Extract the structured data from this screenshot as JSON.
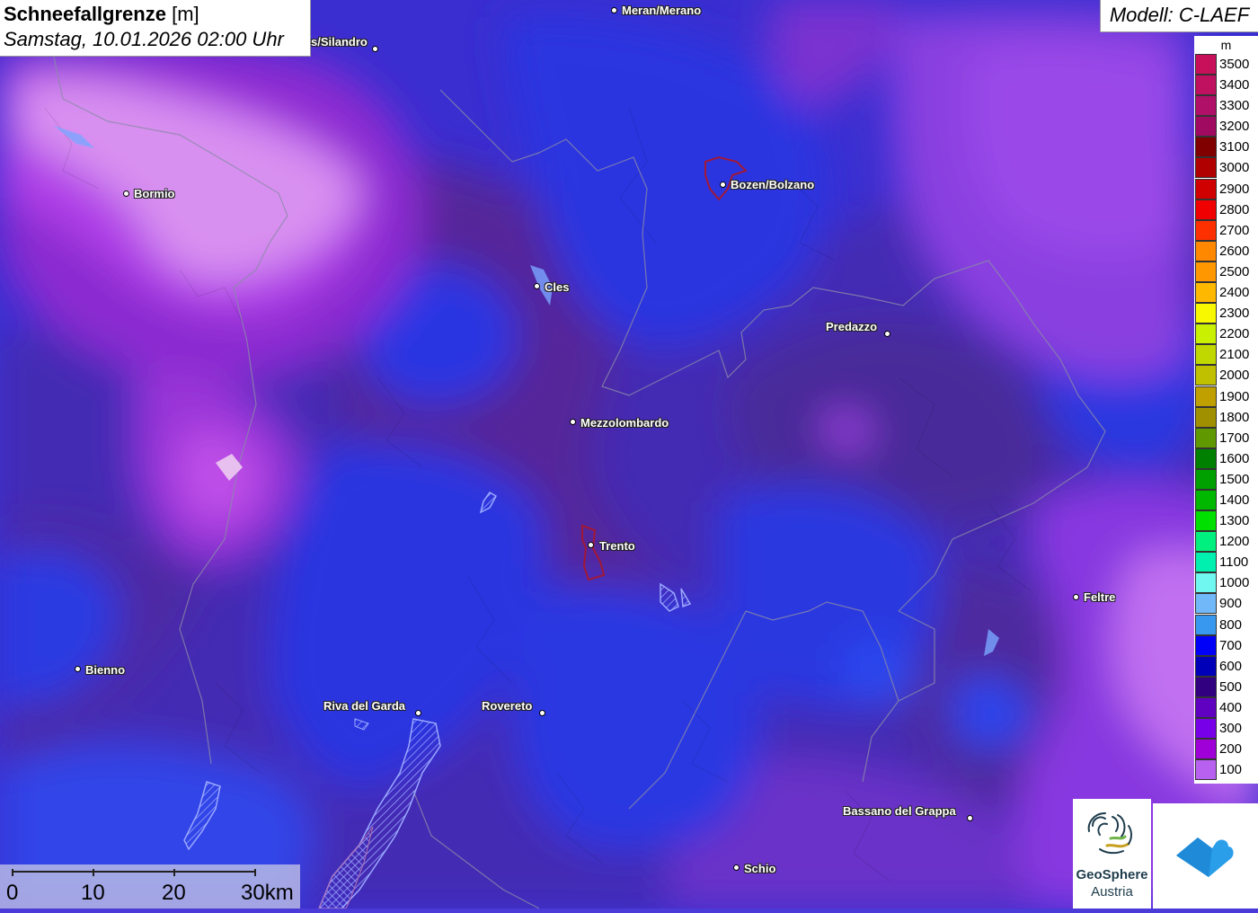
{
  "title": {
    "main": "Schneefallgrenze",
    "unit": "[m]",
    "datetime": "Samstag, 10.01.2026 02:00 Uhr"
  },
  "model_label": "Modell: C-LAEF",
  "legend": {
    "unit": "m",
    "items": [
      {
        "value": "3500",
        "color": "#c8105a"
      },
      {
        "value": "3400",
        "color": "#c01060"
      },
      {
        "value": "3300",
        "color": "#b01068"
      },
      {
        "value": "3200",
        "color": "#a00a60"
      },
      {
        "value": "3100",
        "color": "#800000"
      },
      {
        "value": "3000",
        "color": "#b00000"
      },
      {
        "value": "2900",
        "color": "#d00000"
      },
      {
        "value": "2800",
        "color": "#f00000"
      },
      {
        "value": "2700",
        "color": "#ff3000"
      },
      {
        "value": "2600",
        "color": "#ff8800"
      },
      {
        "value": "2500",
        "color": "#ff9800"
      },
      {
        "value": "2400",
        "color": "#ffb800"
      },
      {
        "value": "2300",
        "color": "#f8f800"
      },
      {
        "value": "2200",
        "color": "#c8f000"
      },
      {
        "value": "2100",
        "color": "#c0d800"
      },
      {
        "value": "2000",
        "color": "#c0c000"
      },
      {
        "value": "1900",
        "color": "#c0a000"
      },
      {
        "value": "1800",
        "color": "#a09000"
      },
      {
        "value": "1700",
        "color": "#609800"
      },
      {
        "value": "1600",
        "color": "#008000"
      },
      {
        "value": "1500",
        "color": "#00a000"
      },
      {
        "value": "1400",
        "color": "#00b800"
      },
      {
        "value": "1300",
        "color": "#00e000"
      },
      {
        "value": "1200",
        "color": "#00f080"
      },
      {
        "value": "1100",
        "color": "#00f0b0"
      },
      {
        "value": "1000",
        "color": "#70f8f0"
      },
      {
        "value": "900",
        "color": "#70b8f8"
      },
      {
        "value": "800",
        "color": "#3898f0"
      },
      {
        "value": "700",
        "color": "#0000f8"
      },
      {
        "value": "600",
        "color": "#0000b8"
      },
      {
        "value": "500",
        "color": "#300080"
      },
      {
        "value": "400",
        "color": "#6000c0"
      },
      {
        "value": "300",
        "color": "#7800e8"
      },
      {
        "value": "200",
        "color": "#a000d8"
      },
      {
        "value": "100",
        "color": "#b860f0"
      }
    ]
  },
  "cities": [
    {
      "name": "Meran/Merano",
      "id": "meran"
    },
    {
      "name": "s/Silandro",
      "id": "silandro"
    },
    {
      "name": "Bormio",
      "id": "bormio"
    },
    {
      "name": "Bozen/Bolzano",
      "id": "bozen"
    },
    {
      "name": "Cles",
      "id": "cles"
    },
    {
      "name": "Predazzo",
      "id": "predazzo"
    },
    {
      "name": "Mezzolombardo",
      "id": "mezzolombardo"
    },
    {
      "name": "Trento",
      "id": "trento"
    },
    {
      "name": "Feltre",
      "id": "feltre"
    },
    {
      "name": "Bienno",
      "id": "bienno"
    },
    {
      "name": "Riva del Garda",
      "id": "riva"
    },
    {
      "name": "Rovereto",
      "id": "rovereto"
    },
    {
      "name": "Bassano del Grappa",
      "id": "bassano"
    },
    {
      "name": "Schio",
      "id": "schio"
    }
  ],
  "scalebar": {
    "labels": [
      "0",
      "10",
      "20",
      "30km"
    ]
  },
  "logos": {
    "geosphere_line1": "GeoSphere",
    "geosphere_line2": "Austria"
  }
}
